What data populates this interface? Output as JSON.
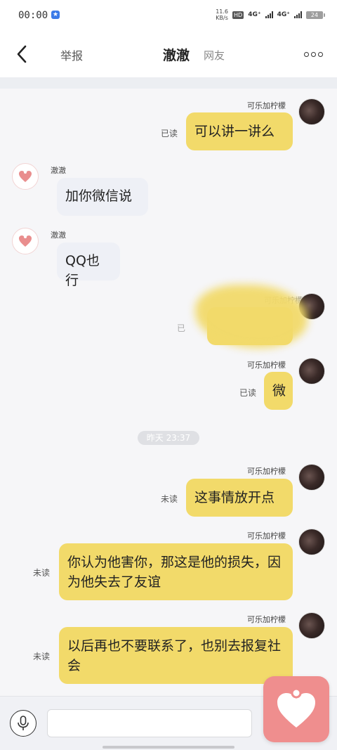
{
  "status_bar": {
    "time": "00:00",
    "speed_value": "11.6",
    "speed_unit": "KB/s",
    "hd": "HD",
    "network_1": "4G⁺",
    "network_2": "4G⁺",
    "battery": "24"
  },
  "header": {
    "report_label": "举报",
    "title": "澈澈",
    "subtitle": "网友"
  },
  "messages": [
    {
      "side": "right",
      "sender": "可乐加柠檬",
      "text": "可以讲一讲么",
      "status": "已读"
    },
    {
      "side": "left",
      "sender": "澈澈",
      "text": "加你微信说"
    },
    {
      "side": "left",
      "sender": "澈澈",
      "text": "QQ也行"
    },
    {
      "side": "right",
      "sender": "可乐加柠檬",
      "text": "",
      "status": "已",
      "redacted": true
    },
    {
      "side": "right",
      "sender": "可乐加柠檬",
      "text": "微",
      "status": "已读"
    },
    {
      "side": "divider",
      "text": "昨天 23:37"
    },
    {
      "side": "right",
      "sender": "可乐加柠檬",
      "text": "这事情放开点",
      "status": "未读"
    },
    {
      "side": "right",
      "sender": "可乐加柠檬",
      "text": "你认为他害你，那这是他的损失，因为他失去了友谊",
      "status": "未读"
    },
    {
      "side": "right",
      "sender": "可乐加柠檬",
      "text": "以后再也不要联系了，也别去报复社会",
      "status": "未读"
    }
  ],
  "input": {
    "value": "",
    "placeholder": ""
  },
  "icons": {
    "back": "back-arrow-icon",
    "more": "more-dots-icon",
    "mic": "microphone-icon",
    "heart": "heart-icon"
  },
  "colors": {
    "my_bubble": "#f2da6a",
    "their_bubble": "#eef0f6",
    "heart_button": "#ef8e8e",
    "heart_avatar": "#e98e8e"
  }
}
